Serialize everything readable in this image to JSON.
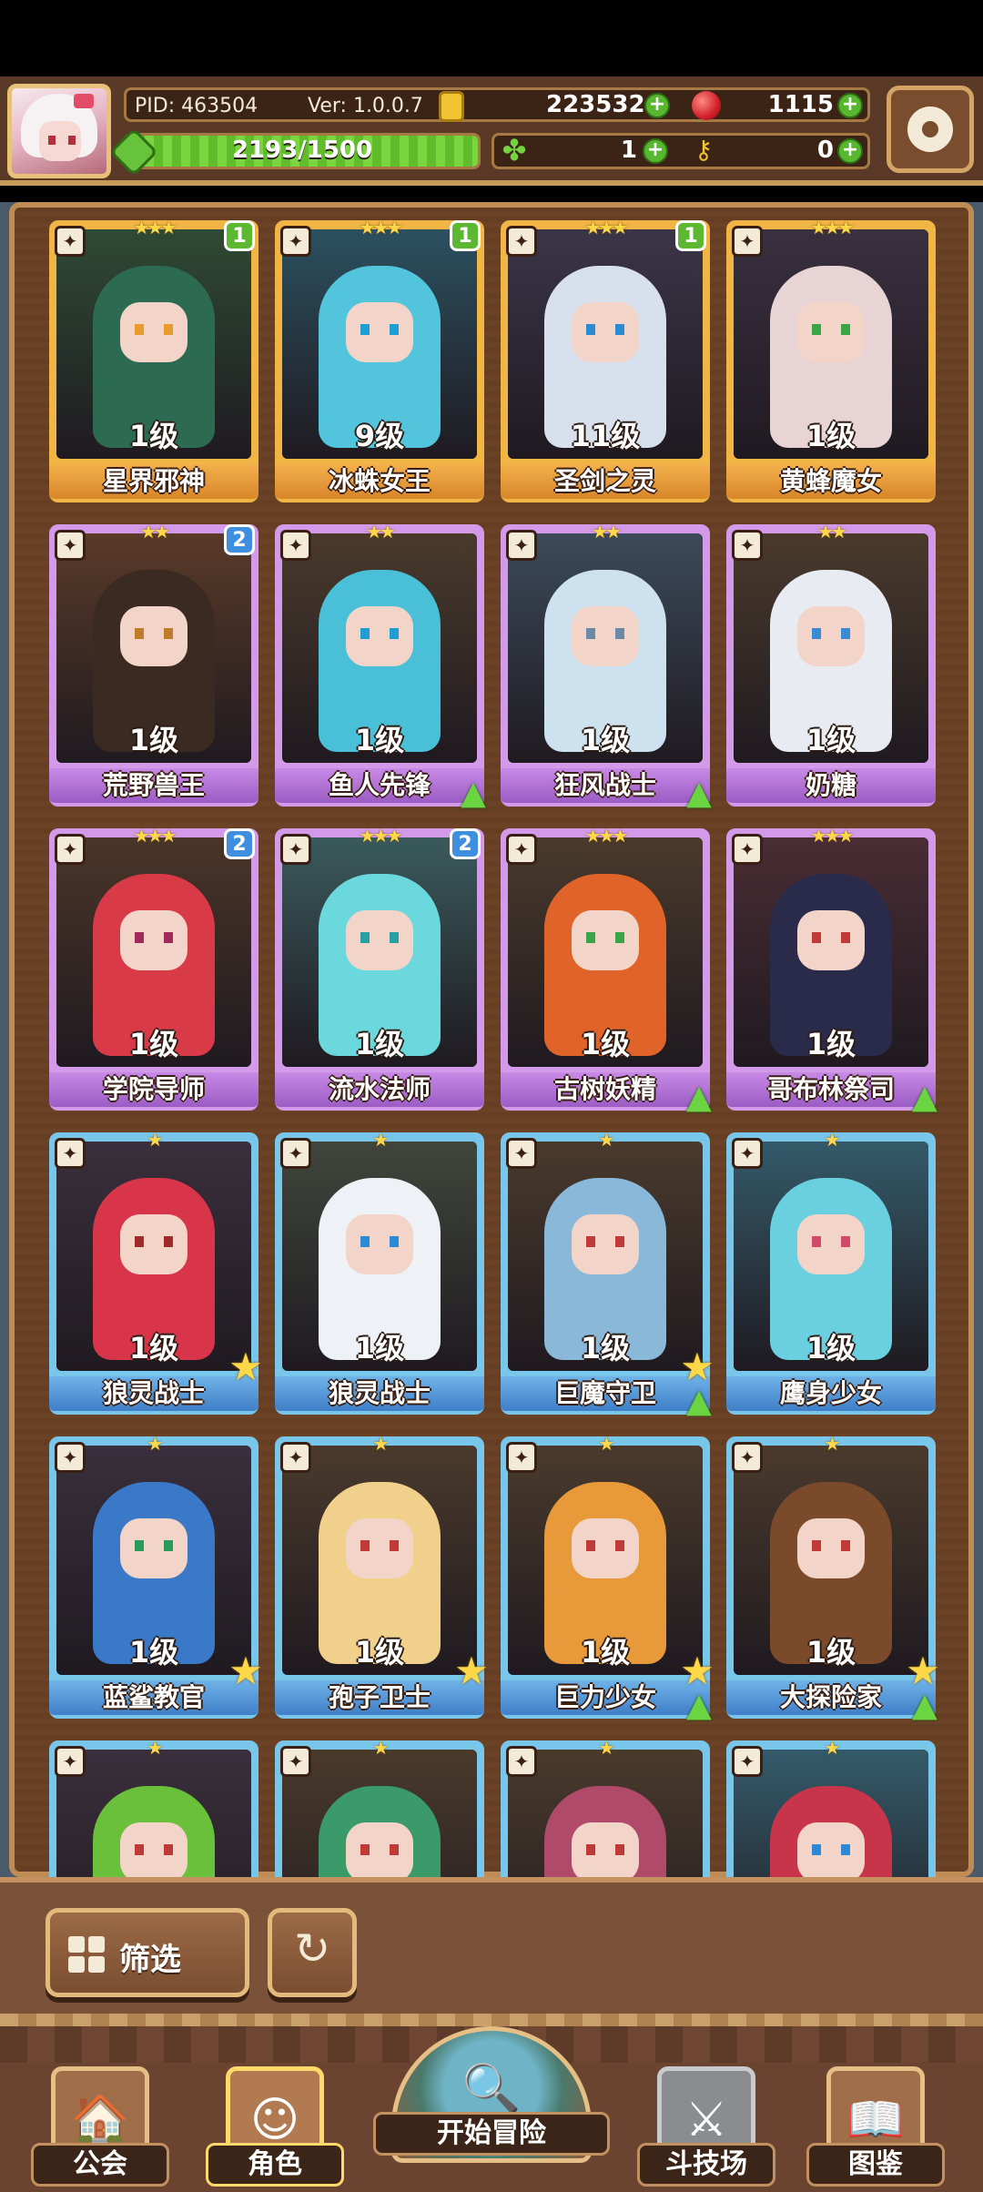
{
  "header": {
    "pid": "PID: 463504",
    "version": "Ver: 1.0.0.7",
    "gold": "223532",
    "gems": "1115",
    "xp": "2193/1500",
    "xp_fill": 1.0,
    "clover": "1",
    "keys": "0"
  },
  "cards": [
    {
      "name": "星界邪神",
      "level": "1级",
      "rarity": "gold",
      "stars": "★★★",
      "badge": "1",
      "badge_color": "green",
      "bg": "#2f4a35",
      "hair": "#2d6a52",
      "eye": "#e89a2a"
    },
    {
      "name": "冰蛛女王",
      "level": "9级",
      "rarity": "gold",
      "stars": "★★★",
      "badge": "1",
      "badge_color": "green",
      "bg": "#2c5060",
      "hair": "#52c4dc",
      "eye": "#1f9ed4"
    },
    {
      "name": "圣剑之灵",
      "level": "11级",
      "rarity": "gold",
      "stars": "★★★",
      "badge": "1",
      "badge_color": "green",
      "bg": "#3b3548",
      "hair": "#d8e0ee",
      "eye": "#2a8ad4"
    },
    {
      "name": "黄蜂魔女",
      "level": "1级",
      "rarity": "gold",
      "stars": "★★★",
      "badge": "",
      "badge_color": "",
      "bg": "#3a3040",
      "hair": "#e8d4d4",
      "eye": "#3aa448"
    },
    {
      "name": "荒野兽王",
      "level": "1级",
      "rarity": "purple",
      "stars": "★★",
      "badge": "2",
      "badge_color": "blue",
      "bg": "#5a3a28",
      "hair": "#3a2a22",
      "eye": "#c07a2a"
    },
    {
      "name": "鱼人先锋",
      "level": "1级",
      "rarity": "purple",
      "stars": "★★",
      "badge": "",
      "badge_color": "",
      "bg": "#4a3a2c",
      "hair": "#4ac0d8",
      "eye": "#1f9ed4",
      "upgrade": true
    },
    {
      "name": "狂风战士",
      "level": "1级",
      "rarity": "purple",
      "stars": "★★",
      "badge": "",
      "badge_color": "",
      "bg": "#3c4a5a",
      "hair": "#cde2ee",
      "eye": "#6a8aa8",
      "upgrade": true
    },
    {
      "name": "奶糖",
      "level": "1级",
      "rarity": "purple",
      "stars": "★★",
      "badge": "",
      "badge_color": "",
      "bg": "#4a3a2c",
      "hair": "#e8ecf2",
      "eye": "#3a8ad4"
    },
    {
      "name": "学院导师",
      "level": "1级",
      "rarity": "purple",
      "stars": "★★★",
      "badge": "2",
      "badge_color": "blue",
      "bg": "#4a3528",
      "hair": "#d83a48",
      "eye": "#a02a5a"
    },
    {
      "name": "流水法师",
      "level": "1级",
      "rarity": "purple",
      "stars": "★★★",
      "badge": "2",
      "badge_color": "blue",
      "bg": "#3a5a5c",
      "hair": "#6ad8dc",
      "eye": "#2aa0a4"
    },
    {
      "name": "古树妖精",
      "level": "1级",
      "rarity": "purple",
      "stars": "★★★",
      "badge": "",
      "badge_color": "",
      "bg": "#4a3a2c",
      "hair": "#e0642a",
      "eye": "#3aa448",
      "upgrade": true
    },
    {
      "name": "哥布林祭司",
      "level": "1级",
      "rarity": "purple",
      "stars": "★★★",
      "badge": "",
      "badge_color": "",
      "bg": "#4a2c34",
      "hair": "#2a2a4a",
      "eye": "#c03a3a",
      "upgrade": true
    },
    {
      "name": "狼灵战士",
      "level": "1级",
      "rarity": "blue",
      "stars": "★",
      "badge": "",
      "badge_color": "",
      "bg": "#3a2f3c",
      "hair": "#d8344a",
      "eye": "#a02a2a",
      "star_badge": true
    },
    {
      "name": "狼灵战士",
      "level": "1级",
      "rarity": "blue",
      "stars": "★",
      "badge": "",
      "badge_color": "",
      "bg": "#40463c",
      "hair": "#eef2f6",
      "eye": "#2a8ad4"
    },
    {
      "name": "巨魔守卫",
      "level": "1级",
      "rarity": "blue",
      "stars": "★",
      "badge": "",
      "badge_color": "",
      "bg": "#4a3a2c",
      "hair": "#8ab8d8",
      "eye": "#c03a3a",
      "upgrade": true,
      "star_badge": true
    },
    {
      "name": "鹰身少女",
      "level": "1级",
      "rarity": "blue",
      "stars": "★",
      "badge": "",
      "badge_color": "",
      "bg": "#345a6a",
      "hair": "#6ad0e0",
      "eye": "#d04a6a"
    },
    {
      "name": "蓝鲨教官",
      "level": "1级",
      "rarity": "blue",
      "stars": "★",
      "badge": "",
      "badge_color": "",
      "bg": "#3a2f3c",
      "hair": "#3a78c8",
      "eye": "#2a9a5a",
      "star_badge": true
    },
    {
      "name": "孢子卫士",
      "level": "1级",
      "rarity": "blue",
      "stars": "★",
      "badge": "",
      "badge_color": "",
      "bg": "#4a3a2c",
      "hair": "#f0d08a",
      "eye": "#c03a3a",
      "star_badge": true
    },
    {
      "name": "巨力少女",
      "level": "1级",
      "rarity": "blue",
      "stars": "★",
      "badge": "",
      "badge_color": "",
      "bg": "#4a3a2c",
      "hair": "#e89a3a",
      "eye": "#c03a3a",
      "upgrade": true,
      "star_badge": true
    },
    {
      "name": "大探险家",
      "level": "1级",
      "rarity": "blue",
      "stars": "★",
      "badge": "",
      "badge_color": "",
      "bg": "#4a3a2c",
      "hair": "#7a4a2a",
      "eye": "#c03a3a",
      "upgrade": true,
      "star_badge": true
    },
    {
      "name": "",
      "level": "",
      "rarity": "blue",
      "stars": "★",
      "badge": "",
      "badge_color": "",
      "bg": "#3a2f3c",
      "hair": "#6ac03a",
      "eye": "#c03a3a"
    },
    {
      "name": "",
      "level": "",
      "rarity": "blue",
      "stars": "★",
      "badge": "",
      "badge_color": "",
      "bg": "#4a3a2c",
      "hair": "#3a9a6a",
      "eye": "#c03a3a"
    },
    {
      "name": "",
      "level": "",
      "rarity": "blue",
      "stars": "★",
      "badge": "",
      "badge_color": "",
      "bg": "#4a3a2c",
      "hair": "#b04a6a",
      "eye": "#c03a3a"
    },
    {
      "name": "",
      "level": "",
      "rarity": "blue",
      "stars": "★",
      "badge": "",
      "badge_color": "",
      "bg": "#345a6a",
      "hair": "#c8344a",
      "eye": "#2a8ad4"
    }
  ],
  "controls": {
    "filter_label": "筛选"
  },
  "nav": {
    "guild": "公会",
    "character": "角色",
    "adventure": "开始冒险",
    "arena": "斗技场",
    "codex": "图鉴"
  },
  "colors": {
    "gold_frame": "#f0b545",
    "purple_frame": "#d49aea",
    "blue_frame": "#78c6ea",
    "accent_green": "#57b72f"
  }
}
